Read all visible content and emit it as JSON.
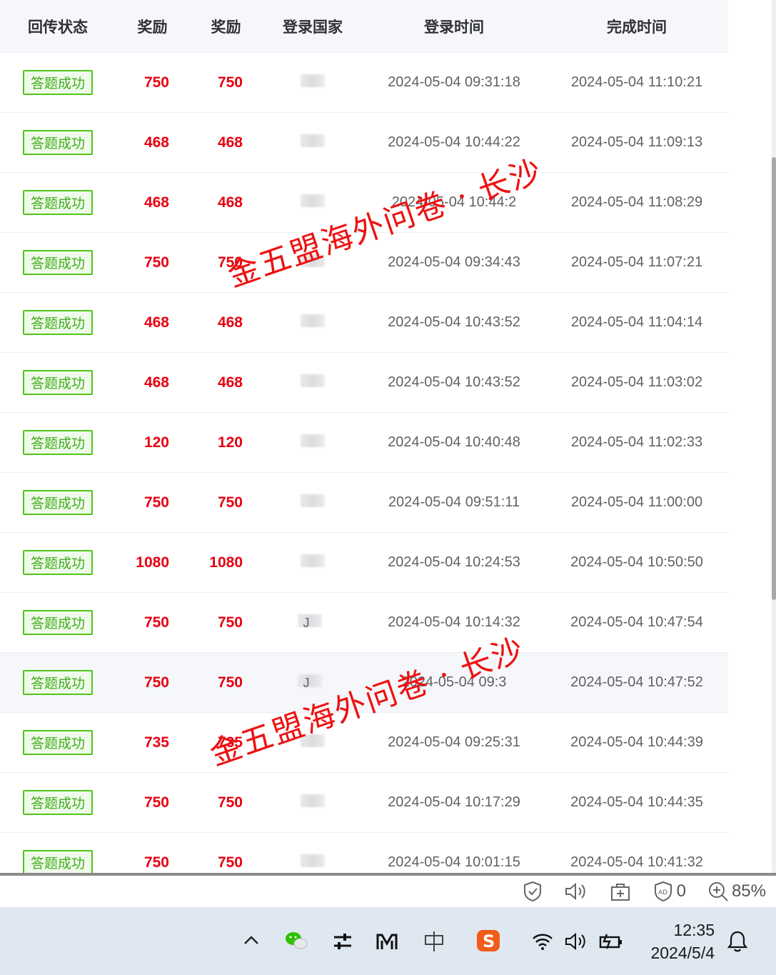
{
  "table": {
    "headers": [
      "回传状态",
      "奖励",
      "奖励",
      "登录国家",
      "登录时间",
      "完成时间"
    ],
    "rows": [
      {
        "status": "答题成功",
        "reward1": "750",
        "reward2": "750",
        "country": "",
        "login": "2024-05-04 09:31:18",
        "done": "2024-05-04 11:10:21"
      },
      {
        "status": "答题成功",
        "reward1": "468",
        "reward2": "468",
        "country": "",
        "login": "2024-05-04 10:44:22",
        "done": "2024-05-04 11:09:13"
      },
      {
        "status": "答题成功",
        "reward1": "468",
        "reward2": "468",
        "country": "",
        "login": "2024-05-04 10:44:2",
        "done": "2024-05-04 11:08:29"
      },
      {
        "status": "答题成功",
        "reward1": "750",
        "reward2": "750",
        "country": "",
        "login": "2024-05-04 09:34:43",
        "done": "2024-05-04 11:07:21"
      },
      {
        "status": "答题成功",
        "reward1": "468",
        "reward2": "468",
        "country": "",
        "login": "2024-05-04 10:43:52",
        "done": "2024-05-04 11:04:14"
      },
      {
        "status": "答题成功",
        "reward1": "468",
        "reward2": "468",
        "country": "",
        "login": "2024-05-04 10:43:52",
        "done": "2024-05-04 11:03:02"
      },
      {
        "status": "答题成功",
        "reward1": "120",
        "reward2": "120",
        "country": "",
        "login": "2024-05-04 10:40:48",
        "done": "2024-05-04 11:02:33"
      },
      {
        "status": "答题成功",
        "reward1": "750",
        "reward2": "750",
        "country": "",
        "login": "2024-05-04 09:51:11",
        "done": "2024-05-04 11:00:00"
      },
      {
        "status": "答题成功",
        "reward1": "1080",
        "reward2": "1080",
        "country": "",
        "login": "2024-05-04 10:24:53",
        "done": "2024-05-04 10:50:50"
      },
      {
        "status": "答题成功",
        "reward1": "750",
        "reward2": "750",
        "country": "J",
        "login": "2024-05-04 10:14:32",
        "done": "2024-05-04 10:47:54"
      },
      {
        "status": "答题成功",
        "reward1": "750",
        "reward2": "750",
        "country": "J",
        "login": "2024-05-04 09:3",
        "done": "2024-05-04 10:47:52"
      },
      {
        "status": "答题成功",
        "reward1": "735",
        "reward2": "735",
        "country": "",
        "login": "2024-05-04 09:25:31",
        "done": "2024-05-04 10:44:39"
      },
      {
        "status": "答题成功",
        "reward1": "750",
        "reward2": "750",
        "country": "",
        "login": "2024-05-04 10:17:29",
        "done": "2024-05-04 10:44:35"
      },
      {
        "status": "答题成功",
        "reward1": "750",
        "reward2": "750",
        "country": "",
        "login": "2024-05-04 10:01:15",
        "done": "2024-05-04 10:41:32"
      }
    ]
  },
  "watermark": "金五盟海外问卷 · 长沙",
  "statusbar": {
    "adblock_count": "0",
    "zoom": "85%"
  },
  "taskbar": {
    "time": "12:35",
    "date": "2024/5/4"
  },
  "colors": {
    "reward": "#e60012",
    "badge": "#52c41a",
    "watermark": "#ee1111"
  }
}
